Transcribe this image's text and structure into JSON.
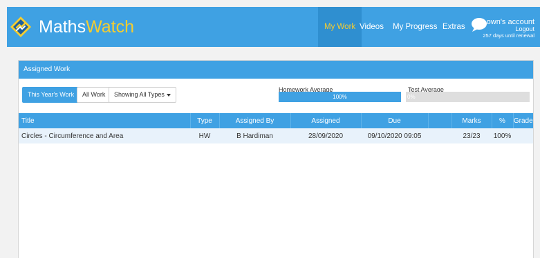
{
  "brand": {
    "part1": "Maths",
    "part2": "Watch"
  },
  "nav": {
    "my_work": "My Work",
    "videos": "Videos",
    "my_progress": "My Progress",
    "extras": "Extras"
  },
  "account": {
    "name": "Lown's account",
    "logout": "Logout",
    "renewal": "257 days until renewal"
  },
  "panel": {
    "title": "Assigned Work",
    "buttons": {
      "this_year": "This Year's Work",
      "all_work": "All Work",
      "filter": "Showing All Types"
    },
    "homework_average": {
      "label": "Homework Average",
      "value_text": "100%",
      "fraction": 1.0
    },
    "test_average": {
      "label": "Test Average",
      "value_text": "0%",
      "fraction": 0.0
    }
  },
  "table": {
    "headers": {
      "title": "Title",
      "type": "Type",
      "assigned_by": "Assigned By",
      "assigned": "Assigned",
      "due": "Due",
      "marks": "Marks",
      "percent": "%",
      "grade": "Grade"
    },
    "rows": [
      {
        "title": "Circles - Circumference and Area",
        "type": "HW",
        "assigned_by": "B Hardiman",
        "assigned": "28/09/2020",
        "due": "09/10/2020 09:05",
        "marks": "23/23",
        "percent": "100%",
        "grade": ""
      }
    ]
  },
  "colors": {
    "primary": "#3fa1e3",
    "active_nav": "#2f8fd0",
    "accent_yellow": "#f5cd30",
    "row_highlight": "#e8f2fb"
  },
  "icons": {
    "logo": "mathswatch-logo-icon",
    "chat": "chat-bubble-icon",
    "caret": "caret-down-icon"
  }
}
